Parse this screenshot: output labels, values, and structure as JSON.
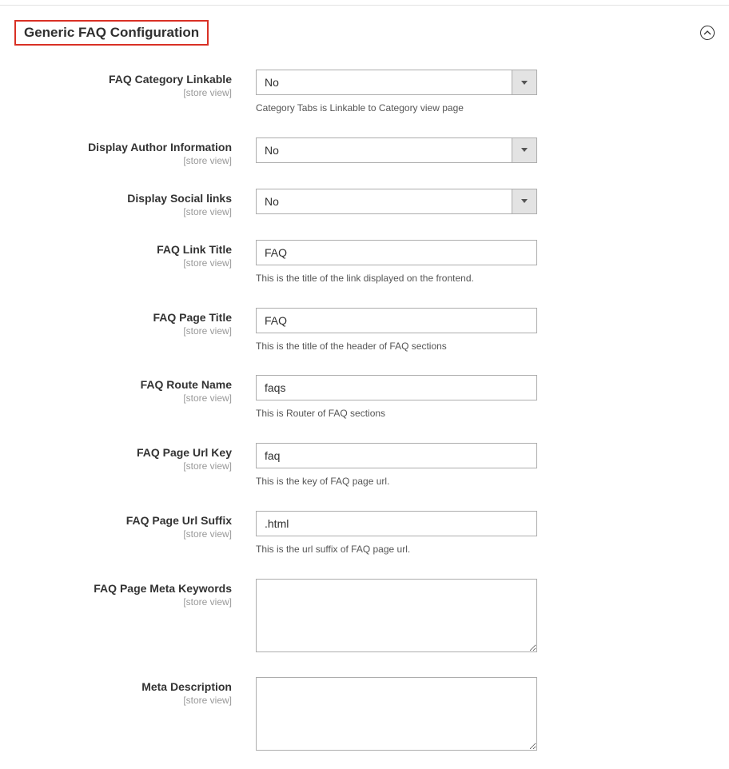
{
  "section": {
    "title": "Generic FAQ Configuration"
  },
  "scope_label": "[store view]",
  "fields": {
    "category_linkable": {
      "label": "FAQ Category Linkable",
      "value": "No",
      "note": "Category Tabs is Linkable to Category view page"
    },
    "display_author": {
      "label": "Display Author Information",
      "value": "No"
    },
    "display_social": {
      "label": "Display Social links",
      "value": "No"
    },
    "link_title": {
      "label": "FAQ Link Title",
      "value": "FAQ",
      "note": "This is the title of the link displayed on the frontend."
    },
    "page_title": {
      "label": "FAQ Page Title",
      "value": "FAQ",
      "note": "This is the title of the header of FAQ sections"
    },
    "route_name": {
      "label": "FAQ Route Name",
      "value": "faqs",
      "note": "This is Router of FAQ sections"
    },
    "url_key": {
      "label": "FAQ Page Url Key",
      "value": "faq",
      "note": "This is the key of FAQ page url."
    },
    "url_suffix": {
      "label": "FAQ Page Url Suffix",
      "value": ".html",
      "note": "This is the url suffix of FAQ page url."
    },
    "meta_keywords": {
      "label": "FAQ Page Meta Keywords",
      "value": ""
    },
    "meta_description": {
      "label": "Meta Description",
      "value": ""
    }
  }
}
